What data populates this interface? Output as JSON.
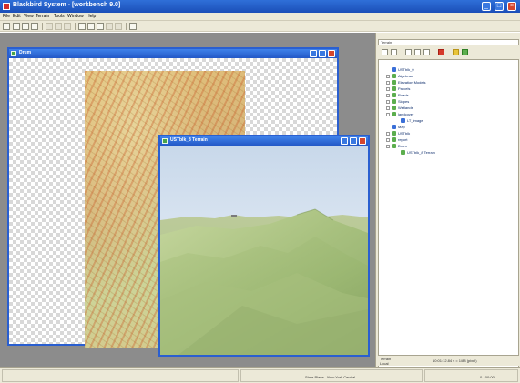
{
  "app": {
    "title": "Blackbird System - [workbench 9.0]",
    "window_buttons": [
      "minimize-button",
      "maximize-button",
      "close-button"
    ]
  },
  "menu": [
    "File",
    "Edit",
    "View",
    "Terrain",
    "Tools",
    "Window",
    "Help"
  ],
  "map_window": {
    "title": "Drum"
  },
  "terrain_window": {
    "title": "USTblk_8 Terrain"
  },
  "right_panel": {
    "header": "Terrain",
    "tree": [
      {
        "label": "USTblk_0",
        "color": "#3a6fd8"
      },
      {
        "label": "Algebras",
        "color": "#5cae4e"
      },
      {
        "label": "Elevation Models",
        "color": "#5cae4e"
      },
      {
        "label": "Parcels",
        "color": "#5cae4e"
      },
      {
        "label": "Roads",
        "color": "#5cae4e"
      },
      {
        "label": "Slopes",
        "color": "#5cae4e"
      },
      {
        "label": "Wetlands",
        "color": "#5cae4e"
      },
      {
        "label": "landcover",
        "color": "#5cae4e"
      },
      {
        "label": "LT_image",
        "color": "#3a6fd8"
      },
      {
        "label": "Map",
        "color": "#3a6fd8"
      },
      {
        "label": "USTblk",
        "color": "#5cae4e"
      },
      {
        "label": "report",
        "color": "#5cae4e"
      },
      {
        "label": "Drum",
        "color": "#5cae4e"
      },
      {
        "label": "USTblk_8 Terrain",
        "color": "#5cae4e"
      }
    ],
    "status_left": "Terrain",
    "status_left2": "Local",
    "status_right": "10:01:12.84 s = 1/88 (pixel)"
  },
  "statusbar": {
    "center": "State Plane - New York Central",
    "right": "0 - 00:00"
  }
}
